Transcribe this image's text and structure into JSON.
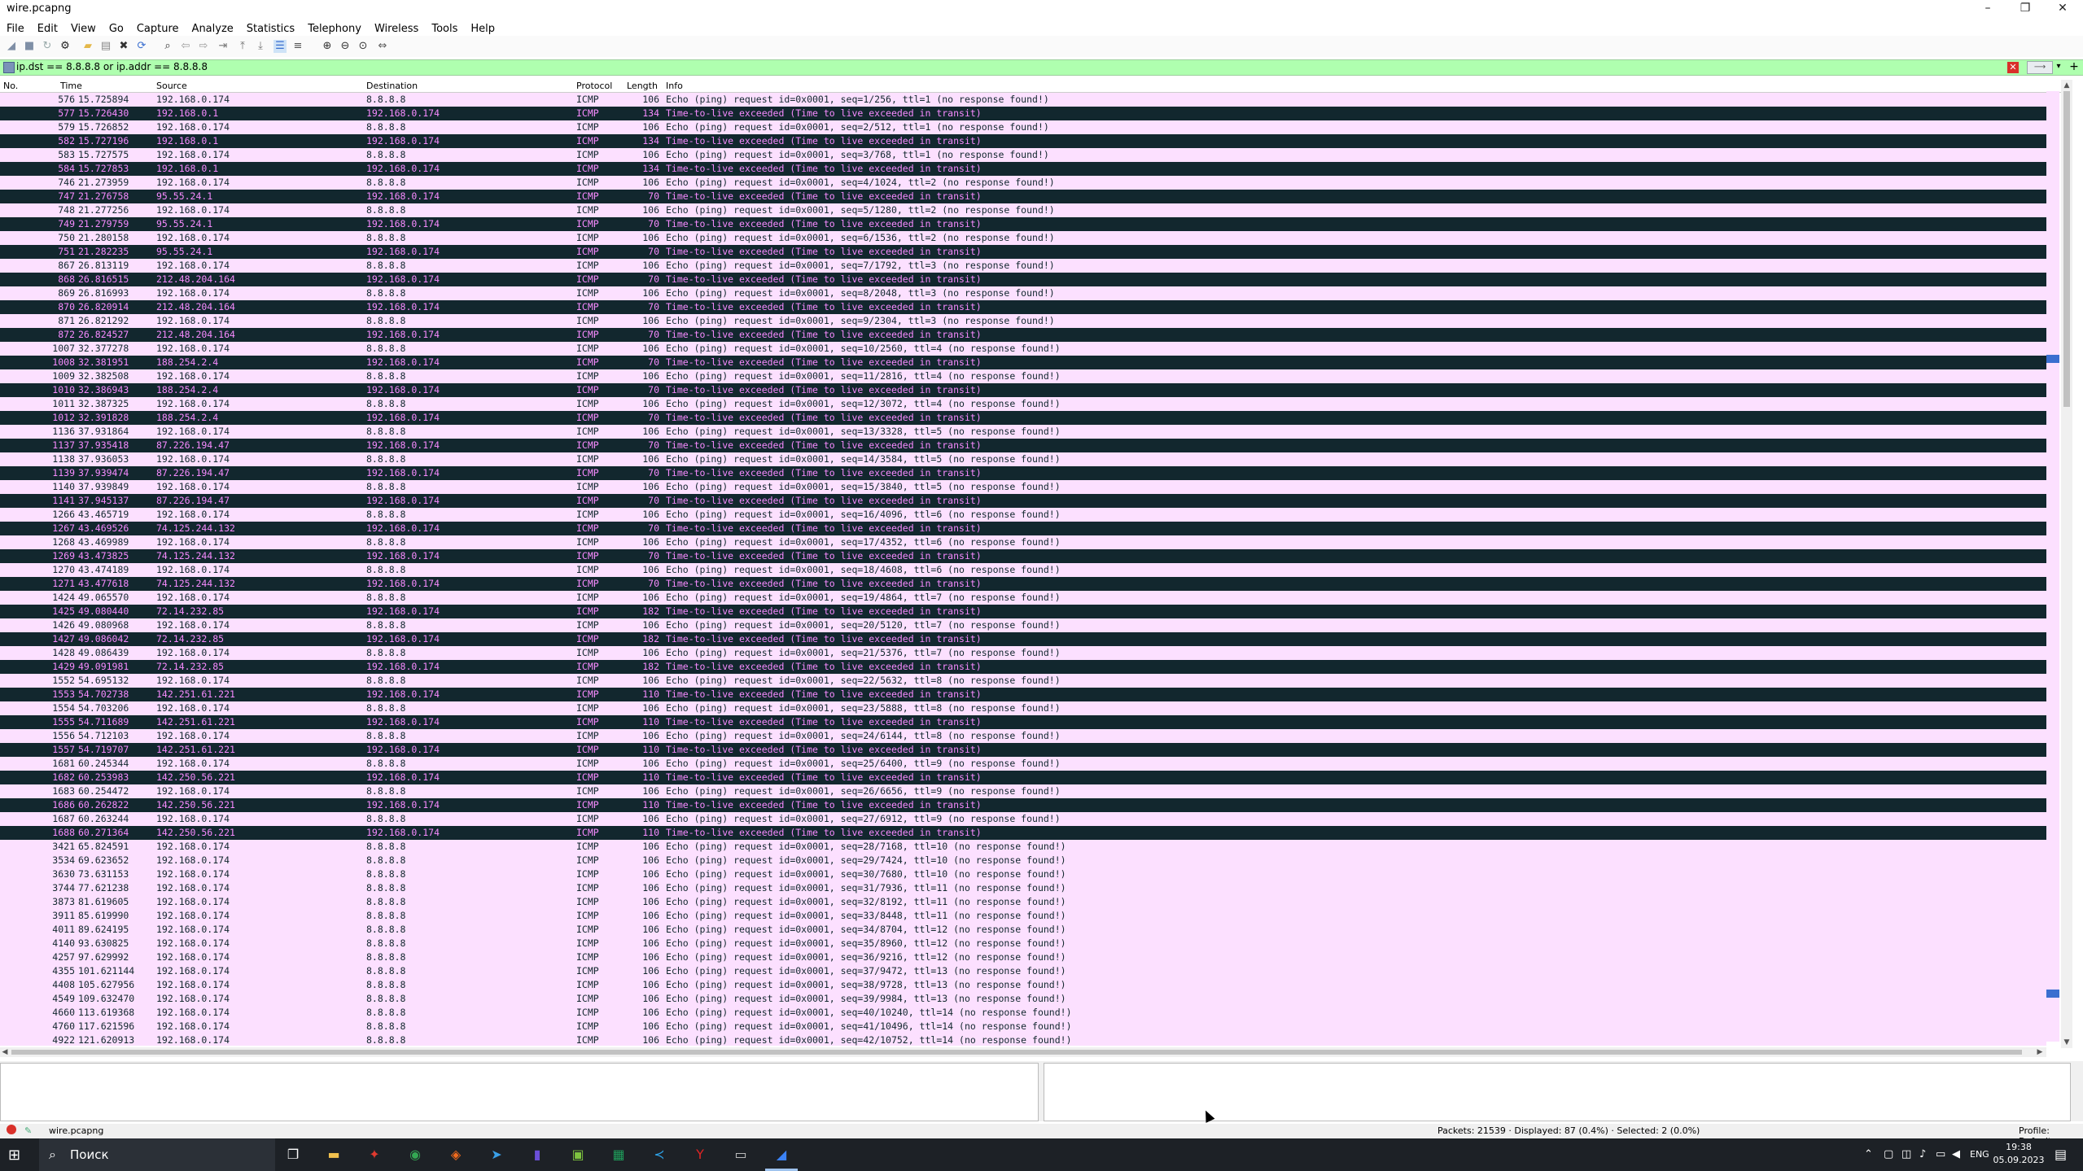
{
  "window": {
    "title": "wire.pcapng",
    "minimize": "–",
    "maximize": "❐",
    "close": "✕"
  },
  "menu": [
    "File",
    "Edit",
    "View",
    "Go",
    "Capture",
    "Analyze",
    "Statistics",
    "Telephony",
    "Wireless",
    "Tools",
    "Help"
  ],
  "filter": {
    "value": "ip.dst == 8.8.8.8 or ip.addr == 8.8.8.8",
    "bg_color": "#afffaf"
  },
  "columns": [
    "No.",
    "Time",
    "Source",
    "Destination",
    "Protocol",
    "Length",
    "Info"
  ],
  "colors": {
    "request_bg": "#fce0ff",
    "ttl_bg": "#12272e",
    "ttl_fg": "#f78bff"
  },
  "packets": [
    {
      "no": "576",
      "time": "15.725894",
      "src": "192.168.0.174",
      "dst": "8.8.8.8",
      "proto": "ICMP",
      "len": "106",
      "info": "Echo (ping) request  id=0x0001, seq=1/256, ttl=1 (no response found!)"
    },
    {
      "no": "577",
      "time": "15.726430",
      "src": "192.168.0.1",
      "dst": "192.168.0.174",
      "proto": "ICMP",
      "len": "134",
      "info": "Time-to-live exceeded (Time to live exceeded in transit)"
    },
    {
      "no": "579",
      "time": "15.726852",
      "src": "192.168.0.174",
      "dst": "8.8.8.8",
      "proto": "ICMP",
      "len": "106",
      "info": "Echo (ping) request  id=0x0001, seq=2/512, ttl=1 (no response found!)"
    },
    {
      "no": "582",
      "time": "15.727196",
      "src": "192.168.0.1",
      "dst": "192.168.0.174",
      "proto": "ICMP",
      "len": "134",
      "info": "Time-to-live exceeded (Time to live exceeded in transit)"
    },
    {
      "no": "583",
      "time": "15.727575",
      "src": "192.168.0.174",
      "dst": "8.8.8.8",
      "proto": "ICMP",
      "len": "106",
      "info": "Echo (ping) request  id=0x0001, seq=3/768, ttl=1 (no response found!)"
    },
    {
      "no": "584",
      "time": "15.727853",
      "src": "192.168.0.1",
      "dst": "192.168.0.174",
      "proto": "ICMP",
      "len": "134",
      "info": "Time-to-live exceeded (Time to live exceeded in transit)"
    },
    {
      "no": "746",
      "time": "21.273959",
      "src": "192.168.0.174",
      "dst": "8.8.8.8",
      "proto": "ICMP",
      "len": "106",
      "info": "Echo (ping) request  id=0x0001, seq=4/1024, ttl=2 (no response found!)"
    },
    {
      "no": "747",
      "time": "21.276758",
      "src": "95.55.24.1",
      "dst": "192.168.0.174",
      "proto": "ICMP",
      "len": "70",
      "info": "Time-to-live exceeded (Time to live exceeded in transit)"
    },
    {
      "no": "748",
      "time": "21.277256",
      "src": "192.168.0.174",
      "dst": "8.8.8.8",
      "proto": "ICMP",
      "len": "106",
      "info": "Echo (ping) request  id=0x0001, seq=5/1280, ttl=2 (no response found!)"
    },
    {
      "no": "749",
      "time": "21.279759",
      "src": "95.55.24.1",
      "dst": "192.168.0.174",
      "proto": "ICMP",
      "len": "70",
      "info": "Time-to-live exceeded (Time to live exceeded in transit)"
    },
    {
      "no": "750",
      "time": "21.280158",
      "src": "192.168.0.174",
      "dst": "8.8.8.8",
      "proto": "ICMP",
      "len": "106",
      "info": "Echo (ping) request  id=0x0001, seq=6/1536, ttl=2 (no response found!)"
    },
    {
      "no": "751",
      "time": "21.282235",
      "src": "95.55.24.1",
      "dst": "192.168.0.174",
      "proto": "ICMP",
      "len": "70",
      "info": "Time-to-live exceeded (Time to live exceeded in transit)"
    },
    {
      "no": "867",
      "time": "26.813119",
      "src": "192.168.0.174",
      "dst": "8.8.8.8",
      "proto": "ICMP",
      "len": "106",
      "info": "Echo (ping) request  id=0x0001, seq=7/1792, ttl=3 (no response found!)"
    },
    {
      "no": "868",
      "time": "26.816515",
      "src": "212.48.204.164",
      "dst": "192.168.0.174",
      "proto": "ICMP",
      "len": "70",
      "info": "Time-to-live exceeded (Time to live exceeded in transit)"
    },
    {
      "no": "869",
      "time": "26.816993",
      "src": "192.168.0.174",
      "dst": "8.8.8.8",
      "proto": "ICMP",
      "len": "106",
      "info": "Echo (ping) request  id=0x0001, seq=8/2048, ttl=3 (no response found!)"
    },
    {
      "no": "870",
      "time": "26.820914",
      "src": "212.48.204.164",
      "dst": "192.168.0.174",
      "proto": "ICMP",
      "len": "70",
      "info": "Time-to-live exceeded (Time to live exceeded in transit)"
    },
    {
      "no": "871",
      "time": "26.821292",
      "src": "192.168.0.174",
      "dst": "8.8.8.8",
      "proto": "ICMP",
      "len": "106",
      "info": "Echo (ping) request  id=0x0001, seq=9/2304, ttl=3 (no response found!)"
    },
    {
      "no": "872",
      "time": "26.824527",
      "src": "212.48.204.164",
      "dst": "192.168.0.174",
      "proto": "ICMP",
      "len": "70",
      "info": "Time-to-live exceeded (Time to live exceeded in transit)"
    },
    {
      "no": "1007",
      "time": "32.377278",
      "src": "192.168.0.174",
      "dst": "8.8.8.8",
      "proto": "ICMP",
      "len": "106",
      "info": "Echo (ping) request  id=0x0001, seq=10/2560, ttl=4 (no response found!)"
    },
    {
      "no": "1008",
      "time": "32.381951",
      "src": "188.254.2.4",
      "dst": "192.168.0.174",
      "proto": "ICMP",
      "len": "70",
      "info": "Time-to-live exceeded (Time to live exceeded in transit)"
    },
    {
      "no": "1009",
      "time": "32.382508",
      "src": "192.168.0.174",
      "dst": "8.8.8.8",
      "proto": "ICMP",
      "len": "106",
      "info": "Echo (ping) request  id=0x0001, seq=11/2816, ttl=4 (no response found!)"
    },
    {
      "no": "1010",
      "time": "32.386943",
      "src": "188.254.2.4",
      "dst": "192.168.0.174",
      "proto": "ICMP",
      "len": "70",
      "info": "Time-to-live exceeded (Time to live exceeded in transit)"
    },
    {
      "no": "1011",
      "time": "32.387325",
      "src": "192.168.0.174",
      "dst": "8.8.8.8",
      "proto": "ICMP",
      "len": "106",
      "info": "Echo (ping) request  id=0x0001, seq=12/3072, ttl=4 (no response found!)"
    },
    {
      "no": "1012",
      "time": "32.391828",
      "src": "188.254.2.4",
      "dst": "192.168.0.174",
      "proto": "ICMP",
      "len": "70",
      "info": "Time-to-live exceeded (Time to live exceeded in transit)"
    },
    {
      "no": "1136",
      "time": "37.931864",
      "src": "192.168.0.174",
      "dst": "8.8.8.8",
      "proto": "ICMP",
      "len": "106",
      "info": "Echo (ping) request  id=0x0001, seq=13/3328, ttl=5 (no response found!)"
    },
    {
      "no": "1137",
      "time": "37.935418",
      "src": "87.226.194.47",
      "dst": "192.168.0.174",
      "proto": "ICMP",
      "len": "70",
      "info": "Time-to-live exceeded (Time to live exceeded in transit)"
    },
    {
      "no": "1138",
      "time": "37.936053",
      "src": "192.168.0.174",
      "dst": "8.8.8.8",
      "proto": "ICMP",
      "len": "106",
      "info": "Echo (ping) request  id=0x0001, seq=14/3584, ttl=5 (no response found!)"
    },
    {
      "no": "1139",
      "time": "37.939474",
      "src": "87.226.194.47",
      "dst": "192.168.0.174",
      "proto": "ICMP",
      "len": "70",
      "info": "Time-to-live exceeded (Time to live exceeded in transit)"
    },
    {
      "no": "1140",
      "time": "37.939849",
      "src": "192.168.0.174",
      "dst": "8.8.8.8",
      "proto": "ICMP",
      "len": "106",
      "info": "Echo (ping) request  id=0x0001, seq=15/3840, ttl=5 (no response found!)"
    },
    {
      "no": "1141",
      "time": "37.945137",
      "src": "87.226.194.47",
      "dst": "192.168.0.174",
      "proto": "ICMP",
      "len": "70",
      "info": "Time-to-live exceeded (Time to live exceeded in transit)"
    },
    {
      "no": "1266",
      "time": "43.465719",
      "src": "192.168.0.174",
      "dst": "8.8.8.8",
      "proto": "ICMP",
      "len": "106",
      "info": "Echo (ping) request  id=0x0001, seq=16/4096, ttl=6 (no response found!)"
    },
    {
      "no": "1267",
      "time": "43.469526",
      "src": "74.125.244.132",
      "dst": "192.168.0.174",
      "proto": "ICMP",
      "len": "70",
      "info": "Time-to-live exceeded (Time to live exceeded in transit)"
    },
    {
      "no": "1268",
      "time": "43.469989",
      "src": "192.168.0.174",
      "dst": "8.8.8.8",
      "proto": "ICMP",
      "len": "106",
      "info": "Echo (ping) request  id=0x0001, seq=17/4352, ttl=6 (no response found!)"
    },
    {
      "no": "1269",
      "time": "43.473825",
      "src": "74.125.244.132",
      "dst": "192.168.0.174",
      "proto": "ICMP",
      "len": "70",
      "info": "Time-to-live exceeded (Time to live exceeded in transit)"
    },
    {
      "no": "1270",
      "time": "43.474189",
      "src": "192.168.0.174",
      "dst": "8.8.8.8",
      "proto": "ICMP",
      "len": "106",
      "info": "Echo (ping) request  id=0x0001, seq=18/4608, ttl=6 (no response found!)"
    },
    {
      "no": "1271",
      "time": "43.477618",
      "src": "74.125.244.132",
      "dst": "192.168.0.174",
      "proto": "ICMP",
      "len": "70",
      "info": "Time-to-live exceeded (Time to live exceeded in transit)"
    },
    {
      "no": "1424",
      "time": "49.065570",
      "src": "192.168.0.174",
      "dst": "8.8.8.8",
      "proto": "ICMP",
      "len": "106",
      "info": "Echo (ping) request  id=0x0001, seq=19/4864, ttl=7 (no response found!)"
    },
    {
      "no": "1425",
      "time": "49.080440",
      "src": "72.14.232.85",
      "dst": "192.168.0.174",
      "proto": "ICMP",
      "len": "182",
      "info": "Time-to-live exceeded (Time to live exceeded in transit)"
    },
    {
      "no": "1426",
      "time": "49.080968",
      "src": "192.168.0.174",
      "dst": "8.8.8.8",
      "proto": "ICMP",
      "len": "106",
      "info": "Echo (ping) request  id=0x0001, seq=20/5120, ttl=7 (no response found!)"
    },
    {
      "no": "1427",
      "time": "49.086042",
      "src": "72.14.232.85",
      "dst": "192.168.0.174",
      "proto": "ICMP",
      "len": "182",
      "info": "Time-to-live exceeded (Time to live exceeded in transit)"
    },
    {
      "no": "1428",
      "time": "49.086439",
      "src": "192.168.0.174",
      "dst": "8.8.8.8",
      "proto": "ICMP",
      "len": "106",
      "info": "Echo (ping) request  id=0x0001, seq=21/5376, ttl=7 (no response found!)"
    },
    {
      "no": "1429",
      "time": "49.091981",
      "src": "72.14.232.85",
      "dst": "192.168.0.174",
      "proto": "ICMP",
      "len": "182",
      "info": "Time-to-live exceeded (Time to live exceeded in transit)"
    },
    {
      "no": "1552",
      "time": "54.695132",
      "src": "192.168.0.174",
      "dst": "8.8.8.8",
      "proto": "ICMP",
      "len": "106",
      "info": "Echo (ping) request  id=0x0001, seq=22/5632, ttl=8 (no response found!)"
    },
    {
      "no": "1553",
      "time": "54.702738",
      "src": "142.251.61.221",
      "dst": "192.168.0.174",
      "proto": "ICMP",
      "len": "110",
      "info": "Time-to-live exceeded (Time to live exceeded in transit)"
    },
    {
      "no": "1554",
      "time": "54.703206",
      "src": "192.168.0.174",
      "dst": "8.8.8.8",
      "proto": "ICMP",
      "len": "106",
      "info": "Echo (ping) request  id=0x0001, seq=23/5888, ttl=8 (no response found!)"
    },
    {
      "no": "1555",
      "time": "54.711689",
      "src": "142.251.61.221",
      "dst": "192.168.0.174",
      "proto": "ICMP",
      "len": "110",
      "info": "Time-to-live exceeded (Time to live exceeded in transit)"
    },
    {
      "no": "1556",
      "time": "54.712103",
      "src": "192.168.0.174",
      "dst": "8.8.8.8",
      "proto": "ICMP",
      "len": "106",
      "info": "Echo (ping) request  id=0x0001, seq=24/6144, ttl=8 (no response found!)"
    },
    {
      "no": "1557",
      "time": "54.719707",
      "src": "142.251.61.221",
      "dst": "192.168.0.174",
      "proto": "ICMP",
      "len": "110",
      "info": "Time-to-live exceeded (Time to live exceeded in transit)"
    },
    {
      "no": "1681",
      "time": "60.245344",
      "src": "192.168.0.174",
      "dst": "8.8.8.8",
      "proto": "ICMP",
      "len": "106",
      "info": "Echo (ping) request  id=0x0001, seq=25/6400, ttl=9 (no response found!)"
    },
    {
      "no": "1682",
      "time": "60.253983",
      "src": "142.250.56.221",
      "dst": "192.168.0.174",
      "proto": "ICMP",
      "len": "110",
      "info": "Time-to-live exceeded (Time to live exceeded in transit)"
    },
    {
      "no": "1683",
      "time": "60.254472",
      "src": "192.168.0.174",
      "dst": "8.8.8.8",
      "proto": "ICMP",
      "len": "106",
      "info": "Echo (ping) request  id=0x0001, seq=26/6656, ttl=9 (no response found!)"
    },
    {
      "no": "1686",
      "time": "60.262822",
      "src": "142.250.56.221",
      "dst": "192.168.0.174",
      "proto": "ICMP",
      "len": "110",
      "info": "Time-to-live exceeded (Time to live exceeded in transit)"
    },
    {
      "no": "1687",
      "time": "60.263244",
      "src": "192.168.0.174",
      "dst": "8.8.8.8",
      "proto": "ICMP",
      "len": "106",
      "info": "Echo (ping) request  id=0x0001, seq=27/6912, ttl=9 (no response found!)"
    },
    {
      "no": "1688",
      "time": "60.271364",
      "src": "142.250.56.221",
      "dst": "192.168.0.174",
      "proto": "ICMP",
      "len": "110",
      "info": "Time-to-live exceeded (Time to live exceeded in transit)"
    },
    {
      "no": "3421",
      "time": "65.824591",
      "src": "192.168.0.174",
      "dst": "8.8.8.8",
      "proto": "ICMP",
      "len": "106",
      "info": "Echo (ping) request  id=0x0001, seq=28/7168, ttl=10 (no response found!)"
    },
    {
      "no": "3534",
      "time": "69.623652",
      "src": "192.168.0.174",
      "dst": "8.8.8.8",
      "proto": "ICMP",
      "len": "106",
      "info": "Echo (ping) request  id=0x0001, seq=29/7424, ttl=10 (no response found!)"
    },
    {
      "no": "3630",
      "time": "73.631153",
      "src": "192.168.0.174",
      "dst": "8.8.8.8",
      "proto": "ICMP",
      "len": "106",
      "info": "Echo (ping) request  id=0x0001, seq=30/7680, ttl=10 (no response found!)"
    },
    {
      "no": "3744",
      "time": "77.621238",
      "src": "192.168.0.174",
      "dst": "8.8.8.8",
      "proto": "ICMP",
      "len": "106",
      "info": "Echo (ping) request  id=0x0001, seq=31/7936, ttl=11 (no response found!)"
    },
    {
      "no": "3873",
      "time": "81.619605",
      "src": "192.168.0.174",
      "dst": "8.8.8.8",
      "proto": "ICMP",
      "len": "106",
      "info": "Echo (ping) request  id=0x0001, seq=32/8192, ttl=11 (no response found!)"
    },
    {
      "no": "3911",
      "time": "85.619990",
      "src": "192.168.0.174",
      "dst": "8.8.8.8",
      "proto": "ICMP",
      "len": "106",
      "info": "Echo (ping) request  id=0x0001, seq=33/8448, ttl=11 (no response found!)"
    },
    {
      "no": "4011",
      "time": "89.624195",
      "src": "192.168.0.174",
      "dst": "8.8.8.8",
      "proto": "ICMP",
      "len": "106",
      "info": "Echo (ping) request  id=0x0001, seq=34/8704, ttl=12 (no response found!)"
    },
    {
      "no": "4140",
      "time": "93.630825",
      "src": "192.168.0.174",
      "dst": "8.8.8.8",
      "proto": "ICMP",
      "len": "106",
      "info": "Echo (ping) request  id=0x0001, seq=35/8960, ttl=12 (no response found!)"
    },
    {
      "no": "4257",
      "time": "97.629992",
      "src": "192.168.0.174",
      "dst": "8.8.8.8",
      "proto": "ICMP",
      "len": "106",
      "info": "Echo (ping) request  id=0x0001, seq=36/9216, ttl=12 (no response found!)"
    },
    {
      "no": "4355",
      "time": "101.621144",
      "src": "192.168.0.174",
      "dst": "8.8.8.8",
      "proto": "ICMP",
      "len": "106",
      "info": "Echo (ping) request  id=0x0001, seq=37/9472, ttl=13 (no response found!)"
    },
    {
      "no": "4408",
      "time": "105.627956",
      "src": "192.168.0.174",
      "dst": "8.8.8.8",
      "proto": "ICMP",
      "len": "106",
      "info": "Echo (ping) request  id=0x0001, seq=38/9728, ttl=13 (no response found!)"
    },
    {
      "no": "4549",
      "time": "109.632470",
      "src": "192.168.0.174",
      "dst": "8.8.8.8",
      "proto": "ICMP",
      "len": "106",
      "info": "Echo (ping) request  id=0x0001, seq=39/9984, ttl=13 (no response found!)"
    },
    {
      "no": "4660",
      "time": "113.619368",
      "src": "192.168.0.174",
      "dst": "8.8.8.8",
      "proto": "ICMP",
      "len": "106",
      "info": "Echo (ping) request  id=0x0001, seq=40/10240, ttl=14 (no response found!)"
    },
    {
      "no": "4760",
      "time": "117.621596",
      "src": "192.168.0.174",
      "dst": "8.8.8.8",
      "proto": "ICMP",
      "len": "106",
      "info": "Echo (ping) request  id=0x0001, seq=41/10496, ttl=14 (no response found!)"
    },
    {
      "no": "4922",
      "time": "121.620913",
      "src": "192.168.0.174",
      "dst": "8.8.8.8",
      "proto": "ICMP",
      "len": "106",
      "info": "Echo (ping) request  id=0x0001, seq=42/10752, ttl=14 (no response found!)"
    }
  ],
  "status": {
    "file": "wire.pcapng",
    "packets": "Packets: 21539 · Displayed: 87 (0.4%) · Selected: 2 (0.0%)",
    "profile": "Profile: Default"
  },
  "taskbar": {
    "search_placeholder": "Поиск",
    "lang": "ENG",
    "time": "19:38",
    "date": "05.09.2023"
  }
}
